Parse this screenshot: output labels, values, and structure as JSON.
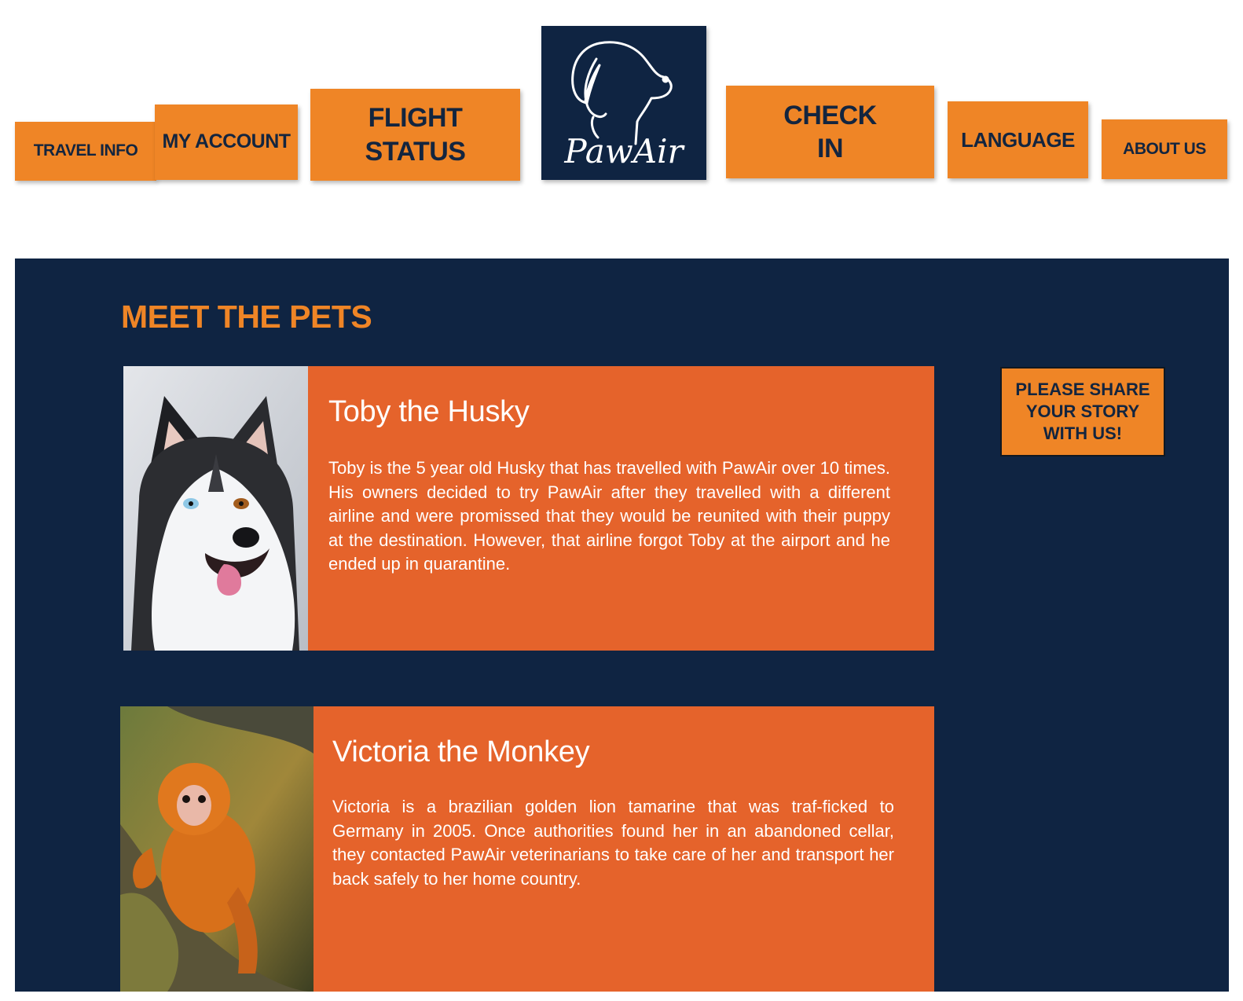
{
  "nav": {
    "travel_info": "TRAVEL INFO",
    "my_account": "MY ACCOUNT",
    "flight_status": "FLIGHT STATUS",
    "check_in": "CHECK IN",
    "language": "LANGUAGE",
    "about_us": "ABOUT US"
  },
  "logo": {
    "text": "PawAir",
    "icon": "dog-head-icon"
  },
  "section": {
    "title": "MEET THE PETS",
    "share_button": "PLEASE SHARE YOUR STORY WITH US!"
  },
  "pets": [
    {
      "name": "Toby the Husky",
      "photo": "husky-photo",
      "description": "Toby is the 5 year old Husky that has travelled with PawAir over 10 times. His owners decided to try PawAir after they travelled with a different airline and were promissed that they would be reunited with their puppy at the destination. However, that airline forgot Toby at the airport and he ended up in quarantine."
    },
    {
      "name": "Victoria the Monkey",
      "photo": "monkey-photo",
      "description": "Victoria is a brazilian golden lion tamarine that was traf-ficked to Germany in 2005. Once authorities found her in an abandoned cellar, they contacted PawAir veterinarians to take care of her and transport her back safely to her home country."
    }
  ],
  "colors": {
    "navy": "#0f2442",
    "nav_orange": "#ef8526",
    "card_orange": "#e5632b"
  }
}
